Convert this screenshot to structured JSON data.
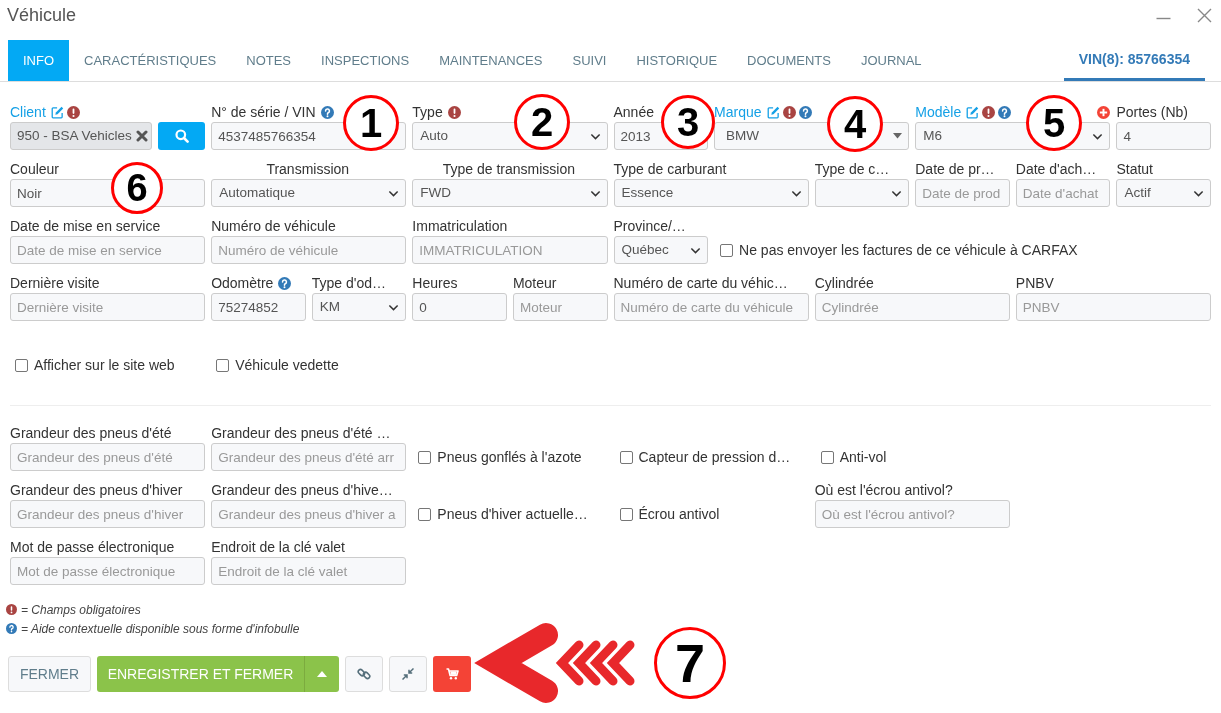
{
  "window": {
    "title": "Véhicule"
  },
  "tabs": [
    {
      "label": "INFO",
      "selected": true
    },
    {
      "label": "CARACTÉRISTIQUES",
      "selected": false
    },
    {
      "label": "NOTES",
      "selected": false
    },
    {
      "label": "INSPECTIONS",
      "selected": false
    },
    {
      "label": "MAINTENANCES",
      "selected": false
    },
    {
      "label": "SUIVI",
      "selected": false
    },
    {
      "label": "HISTORIQUE",
      "selected": false
    },
    {
      "label": "DOCUMENTS",
      "selected": false
    },
    {
      "label": "JOURNAL",
      "selected": false
    }
  ],
  "vin_tab": {
    "label": "VIN(8): 85766354"
  },
  "general_rows": [
    [
      {
        "kind": "client",
        "label": "Client",
        "link": true,
        "editable": true,
        "required": true,
        "value": "950 - BSA Vehicles"
      },
      {
        "kind": "input",
        "label": "N° de série / VIN",
        "help": true,
        "value": "4537485766354"
      },
      {
        "kind": "select",
        "label": "Type",
        "required": true,
        "value": "Auto"
      },
      {
        "kind": "input",
        "label": "Année",
        "value": "2013"
      },
      {
        "kind": "combobox",
        "label": "Marque",
        "link": true,
        "editable": true,
        "required": true,
        "help": true,
        "value": "BMW"
      },
      {
        "kind": "select",
        "label": "Modèle",
        "link": true,
        "editable": true,
        "required": true,
        "help": true,
        "add": true,
        "value": "M6"
      },
      {
        "kind": "input",
        "label": "Portes (Nb)",
        "value": "4"
      }
    ],
    [
      {
        "kind": "input",
        "label": "Couleur",
        "value": "Noir"
      },
      {
        "kind": "select",
        "label": "Transmission",
        "centered": true,
        "value": "Automatique"
      },
      {
        "kind": "select",
        "label": "Type de transmission",
        "centered": true,
        "value": "FWD"
      },
      {
        "kind": "select",
        "label": "Type de carburant",
        "value": "Essence"
      },
      {
        "kind": "select",
        "label": "Type de c…"
      },
      {
        "kind": "input",
        "label": "Date de pr…",
        "placeholder": "Date de prod"
      },
      {
        "kind": "input",
        "label": "Date d'ach…",
        "placeholder": "Date d'achat"
      },
      {
        "kind": "select",
        "label": "Statut",
        "value": "Actif"
      }
    ],
    [
      {
        "kind": "input",
        "label": "Date de mise en service",
        "placeholder": "Date de mise en service"
      },
      {
        "kind": "input",
        "label": "Numéro de véhicule",
        "placeholder": "Numéro de véhicule"
      },
      {
        "kind": "input",
        "label": "Immatriculation",
        "placeholder": "IMMATRICULATION"
      },
      {
        "kind": "select",
        "label": "Province/…",
        "value": "Québec"
      },
      {
        "kind": "checkbox",
        "label": "Ne pas envoyer les factures de ce véhicule à CARFAX",
        "checked": false
      }
    ],
    [
      {
        "kind": "input",
        "label": "Dernière visite",
        "placeholder": "Dernière visite"
      },
      {
        "kind": "input",
        "label": "Odomètre",
        "help": true,
        "value": "75274852"
      },
      {
        "kind": "select",
        "label": "Type d'od…",
        "value": "KM"
      },
      {
        "kind": "input",
        "label": "Heures",
        "value": "0"
      },
      {
        "kind": "input",
        "label": "Moteur",
        "placeholder": "Moteur"
      },
      {
        "kind": "input",
        "label": "Numéro de carte du véhic…",
        "placeholder": "Numéro de carte du véhicule"
      },
      {
        "kind": "input",
        "label": "Cylindrée",
        "placeholder": "Cylindrée"
      },
      {
        "kind": "input",
        "label": "PNBV",
        "placeholder": "PNBV"
      }
    ]
  ],
  "display_options": [
    {
      "label": "Afficher sur le site web",
      "checked": false
    },
    {
      "label": "Véhicule vedette",
      "checked": false
    }
  ],
  "tire_rows": [
    [
      {
        "kind": "input",
        "label": "Grandeur des pneus d'été",
        "placeholder": "Grandeur des pneus d'été"
      },
      {
        "kind": "input",
        "label": "Grandeur des pneus d'été …",
        "placeholder": "Grandeur des pneus d'été arr"
      },
      {
        "kind": "checkbox",
        "label": "Pneus gonflés à l'azote",
        "checked": false
      },
      {
        "kind": "checkbox",
        "label": "Capteur de pression d…",
        "checked": false
      },
      {
        "kind": "checkbox",
        "label": "Anti-vol",
        "checked": false
      }
    ],
    [
      {
        "kind": "input",
        "label": "Grandeur des pneus d'hiver",
        "placeholder": "Grandeur des pneus d'hiver"
      },
      {
        "kind": "input",
        "label": "Grandeur des pneus d'hive…",
        "placeholder": "Grandeur des pneus d'hiver a"
      },
      {
        "kind": "checkbox",
        "label": "Pneus d'hiver actuelle…",
        "checked": false
      },
      {
        "kind": "checkbox",
        "label": "Écrou antivol",
        "checked": false
      },
      {
        "kind": "input",
        "label": "Où est l'écrou antivol?",
        "placeholder": "Où est l'écrou antivol?"
      }
    ],
    [
      {
        "kind": "input",
        "label": "Mot de passe électronique",
        "placeholder": "Mot de passe électronique"
      },
      {
        "kind": "input",
        "label": "Endroit de la clé valet",
        "placeholder": "Endroit de la clé valet"
      }
    ]
  ],
  "legend": [
    {
      "kind": "required",
      "text": "= Champs obligatoires"
    },
    {
      "kind": "help",
      "text": "= Aide contextuelle disponible sous forme d'infobulle"
    }
  ],
  "buttons": [
    {
      "kind": "plain",
      "label": "FERMER"
    },
    {
      "kind": "split",
      "label": "ENREGISTRER ET FERMER"
    },
    {
      "kind": "link"
    },
    {
      "kind": "collapse"
    },
    {
      "kind": "cart"
    }
  ],
  "callouts": [
    {
      "number": "1"
    },
    {
      "number": "2"
    },
    {
      "number": "3"
    },
    {
      "number": "4"
    },
    {
      "number": "5"
    },
    {
      "number": "6"
    },
    {
      "number": "7",
      "arrow": true
    }
  ]
}
